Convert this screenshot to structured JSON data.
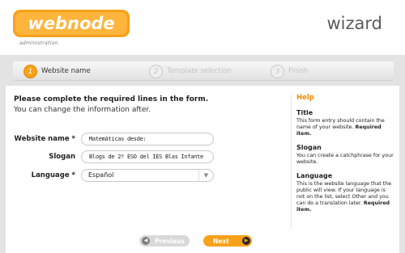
{
  "header": {
    "logo_text": "webnode",
    "logo_sub": "administration",
    "title": "wizard"
  },
  "steps": [
    {
      "num": "1",
      "label": "Website name"
    },
    {
      "num": "2",
      "label": "Template selection"
    },
    {
      "num": "3",
      "label": "Finish"
    }
  ],
  "form": {
    "intro_strong": "Please complete the required lines in the form.",
    "intro_normal": "You can change the information after.",
    "website_name_label": "Website name *",
    "website_name_value": "Matemàticas desde:",
    "slogan_label": "Slogan",
    "slogan_value": "Blogs de 2º ESO del IES Blas Infante",
    "language_label": "Language *",
    "language_value": "Español"
  },
  "buttons": {
    "previous": "Previous",
    "next": "Next"
  },
  "help": {
    "title": "Help",
    "title_section": "Title",
    "title_text": "This form entry should contain the name of your website.",
    "title_required": "Required item.",
    "slogan_section": "Slogan",
    "slogan_text": "You can create a catchphrase for your website.",
    "language_section": "Language",
    "language_text": "This is the website language that the public will view. If your language is not on the list, select Other and you can do a translation later.",
    "language_required": "Required item."
  },
  "colors": {
    "accent": "#f7a11a",
    "help_title": "#f08a00"
  }
}
